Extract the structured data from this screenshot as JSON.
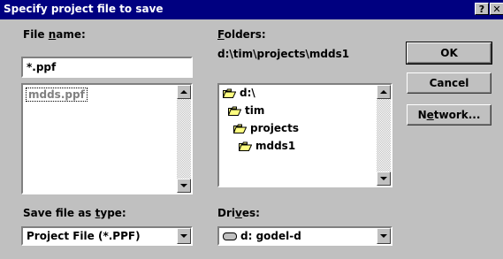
{
  "window": {
    "title": "Specify project file to save",
    "help_label": "?",
    "close_label": "✕"
  },
  "file_name": {
    "label_pre": "File ",
    "label_u": "n",
    "label_post": "ame:",
    "value": "*.ppf"
  },
  "file_list": {
    "items": [
      "mdds.ppf"
    ]
  },
  "folders": {
    "label_pre": "",
    "label_u": "F",
    "label_post": "olders:",
    "path": "d:\\tim\\projects\\mdds1",
    "tree": [
      "d:\\",
      "tim",
      "projects",
      "mdds1"
    ]
  },
  "save_type": {
    "label_pre": "Save file as ",
    "label_u": "t",
    "label_post": "ype:",
    "value": "Project File (*.PPF)"
  },
  "drives": {
    "label_pre": "Dri",
    "label_u": "v",
    "label_post": "es:",
    "value": "d: godel-d"
  },
  "buttons": {
    "ok": "OK",
    "cancel": "Cancel",
    "network_pre": "N",
    "network_u": "e",
    "network_post": "twork..."
  },
  "colors": {
    "titlebar": "#000080",
    "face": "#c0c0c0",
    "folder_yellow": "#ffff80"
  },
  "icons": {
    "folder": "open-folder-icon",
    "drive": "hard-drive-icon"
  }
}
